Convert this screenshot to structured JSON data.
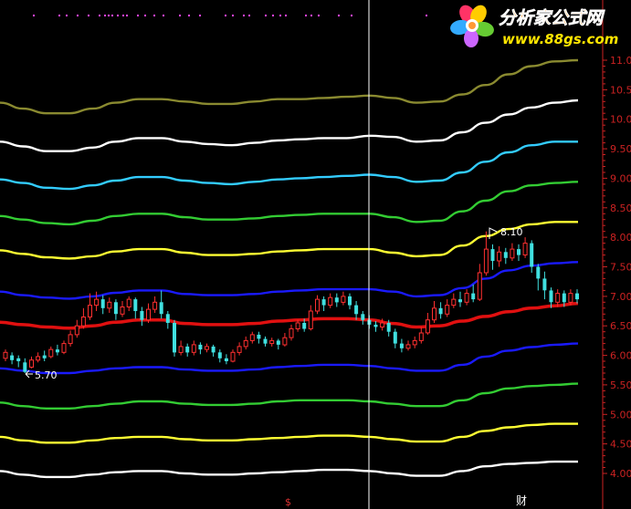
{
  "logo": {
    "title": "分析家公式网",
    "url": "www.88gs.com"
  },
  "price_axis": {
    "ticks": [
      "11.00",
      "10.50",
      "10.00",
      "9.50",
      "9.00",
      "8.50",
      "8.00",
      "7.50",
      "7.00",
      "6.50",
      "6.00",
      "5.50",
      "5.00",
      "4.50",
      "4.00"
    ],
    "tick_values": [
      11.0,
      10.5,
      10.0,
      9.5,
      9.0,
      8.5,
      8.0,
      7.5,
      7.0,
      6.5,
      6.0,
      5.5,
      5.0,
      4.5,
      4.0
    ],
    "color": "#cc2222"
  },
  "annotations": {
    "high_label": "8.10",
    "low_label": "5.70"
  },
  "bottom_markers": {
    "left": "$",
    "right": "财"
  },
  "chart_data": {
    "type": "line",
    "ylim": [
      3.9,
      11.25
    ],
    "bands": [
      {
        "color": "#8a8a30",
        "values": [
          10.28,
          10.18,
          10.1,
          10.1,
          10.18,
          10.28,
          10.34,
          10.34,
          10.3,
          10.26,
          10.26,
          10.3,
          10.34,
          10.34,
          10.36,
          10.38,
          10.4,
          10.36,
          10.28,
          10.3,
          10.42,
          10.58,
          10.76,
          10.9,
          10.98,
          11.0
        ]
      },
      {
        "color": "#ffffff",
        "values": [
          9.62,
          9.54,
          9.46,
          9.46,
          9.52,
          9.62,
          9.68,
          9.68,
          9.62,
          9.58,
          9.56,
          9.6,
          9.64,
          9.66,
          9.68,
          9.68,
          9.72,
          9.7,
          9.62,
          9.64,
          9.78,
          9.94,
          10.08,
          10.2,
          10.28,
          10.32
        ]
      },
      {
        "color": "#33ccff",
        "values": [
          8.98,
          8.92,
          8.84,
          8.82,
          8.88,
          8.96,
          9.02,
          9.02,
          8.96,
          8.92,
          8.9,
          8.94,
          8.98,
          9.0,
          9.02,
          9.04,
          9.06,
          9.02,
          8.94,
          8.96,
          9.1,
          9.28,
          9.44,
          9.56,
          9.62,
          9.62
        ]
      },
      {
        "color": "#33cc33",
        "values": [
          8.36,
          8.3,
          8.24,
          8.22,
          8.28,
          8.36,
          8.4,
          8.4,
          8.34,
          8.3,
          8.3,
          8.32,
          8.36,
          8.38,
          8.4,
          8.4,
          8.4,
          8.34,
          8.26,
          8.28,
          8.44,
          8.62,
          8.78,
          8.88,
          8.92,
          8.94
        ]
      },
      {
        "color": "#ffff33",
        "values": [
          7.78,
          7.72,
          7.66,
          7.64,
          7.68,
          7.76,
          7.8,
          7.8,
          7.74,
          7.7,
          7.7,
          7.72,
          7.76,
          7.78,
          7.8,
          7.8,
          7.8,
          7.74,
          7.68,
          7.7,
          7.86,
          8.02,
          8.14,
          8.22,
          8.26,
          8.26
        ]
      },
      {
        "color": "#1a1aff",
        "values": [
          7.08,
          7.02,
          6.98,
          6.96,
          7.0,
          7.06,
          7.1,
          7.1,
          7.04,
          7.02,
          7.02,
          7.04,
          7.08,
          7.1,
          7.12,
          7.12,
          7.12,
          7.08,
          7.0,
          7.02,
          7.14,
          7.3,
          7.44,
          7.52,
          7.56,
          7.58
        ]
      },
      {
        "color": "#e01010",
        "width": 3.5,
        "values": [
          6.56,
          6.52,
          6.48,
          6.46,
          6.5,
          6.56,
          6.6,
          6.6,
          6.54,
          6.52,
          6.52,
          6.54,
          6.58,
          6.6,
          6.62,
          6.62,
          6.6,
          6.54,
          6.48,
          6.5,
          6.58,
          6.66,
          6.74,
          6.8,
          6.84,
          6.88
        ]
      },
      {
        "color": "#1a1aff",
        "values": [
          5.78,
          5.74,
          5.7,
          5.7,
          5.74,
          5.78,
          5.8,
          5.8,
          5.76,
          5.74,
          5.74,
          5.76,
          5.8,
          5.82,
          5.84,
          5.84,
          5.82,
          5.78,
          5.74,
          5.74,
          5.84,
          5.98,
          6.08,
          6.14,
          6.18,
          6.2
        ]
      },
      {
        "color": "#33cc33",
        "values": [
          5.2,
          5.14,
          5.1,
          5.1,
          5.14,
          5.18,
          5.22,
          5.22,
          5.18,
          5.16,
          5.16,
          5.18,
          5.22,
          5.24,
          5.24,
          5.24,
          5.22,
          5.18,
          5.14,
          5.14,
          5.24,
          5.36,
          5.44,
          5.48,
          5.5,
          5.52
        ]
      },
      {
        "color": "#ffff33",
        "values": [
          4.62,
          4.56,
          4.52,
          4.52,
          4.56,
          4.6,
          4.62,
          4.62,
          4.58,
          4.56,
          4.56,
          4.58,
          4.6,
          4.62,
          4.64,
          4.64,
          4.62,
          4.58,
          4.54,
          4.54,
          4.62,
          4.72,
          4.78,
          4.82,
          4.84,
          4.84
        ]
      },
      {
        "color": "#ffffff",
        "values": [
          4.04,
          3.98,
          3.94,
          3.94,
          3.98,
          4.02,
          4.04,
          4.04,
          4.0,
          3.98,
          3.98,
          4.0,
          4.02,
          4.04,
          4.06,
          4.06,
          4.04,
          4.0,
          3.96,
          3.96,
          4.04,
          4.12,
          4.16,
          4.18,
          4.2,
          4.2
        ]
      }
    ],
    "candles": [
      [
        5.95,
        6.05,
        6.1,
        5.9
      ],
      [
        6.0,
        5.92,
        6.05,
        5.85
      ],
      [
        5.95,
        5.9,
        6.0,
        5.8
      ],
      [
        5.88,
        5.72,
        5.95,
        5.7
      ],
      [
        5.8,
        5.92,
        5.98,
        5.78
      ],
      [
        5.92,
        5.98,
        6.05,
        5.88
      ],
      [
        6.0,
        5.95,
        6.08,
        5.9
      ],
      [
        5.98,
        6.1,
        6.15,
        5.95
      ],
      [
        6.1,
        6.05,
        6.18,
        6.0
      ],
      [
        6.05,
        6.2,
        6.25,
        6.02
      ],
      [
        6.2,
        6.35,
        6.42,
        6.15
      ],
      [
        6.35,
        6.5,
        6.6,
        6.3
      ],
      [
        6.5,
        6.65,
        6.8,
        6.45
      ],
      [
        6.65,
        6.85,
        7.05,
        6.6
      ],
      [
        6.85,
        6.95,
        7.08,
        6.75
      ],
      [
        6.95,
        6.8,
        7.02,
        6.7
      ],
      [
        6.8,
        6.9,
        6.98,
        6.72
      ],
      [
        6.9,
        6.7,
        6.95,
        6.6
      ],
      [
        6.7,
        6.82,
        6.92,
        6.65
      ],
      [
        6.82,
        6.95,
        7.0,
        6.75
      ],
      [
        6.95,
        6.75,
        6.98,
        6.62
      ],
      [
        6.75,
        6.6,
        6.82,
        6.5
      ],
      [
        6.6,
        6.78,
        6.88,
        6.55
      ],
      [
        6.78,
        6.9,
        7.0,
        6.72
      ],
      [
        6.9,
        6.7,
        7.1,
        6.62
      ],
      [
        6.7,
        6.55,
        6.75,
        6.45
      ],
      [
        6.55,
        6.05,
        6.6,
        5.98
      ],
      [
        6.05,
        6.15,
        6.25,
        6.0
      ],
      [
        6.15,
        6.05,
        6.2,
        5.98
      ],
      [
        6.05,
        6.18,
        6.25,
        6.0
      ],
      [
        6.18,
        6.1,
        6.22,
        6.02
      ],
      [
        6.1,
        6.15,
        6.2,
        6.05
      ],
      [
        6.15,
        6.05,
        6.18,
        5.98
      ],
      [
        6.05,
        5.95,
        6.1,
        5.88
      ],
      [
        5.95,
        5.9,
        6.02,
        5.85
      ],
      [
        5.9,
        6.05,
        6.1,
        5.88
      ],
      [
        6.05,
        6.15,
        6.22,
        6.0
      ],
      [
        6.15,
        6.25,
        6.32,
        6.1
      ],
      [
        6.25,
        6.35,
        6.4,
        6.2
      ],
      [
        6.35,
        6.28,
        6.4,
        6.2
      ],
      [
        6.28,
        6.2,
        6.32,
        6.15
      ],
      [
        6.2,
        6.25,
        6.3,
        6.15
      ],
      [
        6.25,
        6.18,
        6.28,
        6.1
      ],
      [
        6.18,
        6.3,
        6.38,
        6.15
      ],
      [
        6.3,
        6.45,
        6.52,
        6.25
      ],
      [
        6.45,
        6.55,
        6.6,
        6.4
      ],
      [
        6.55,
        6.45,
        6.62,
        6.4
      ],
      [
        6.45,
        6.75,
        6.85,
        6.42
      ],
      [
        6.75,
        6.95,
        7.02,
        6.7
      ],
      [
        6.95,
        6.85,
        7.0,
        6.75
      ],
      [
        6.85,
        6.98,
        7.05,
        6.8
      ],
      [
        6.98,
        6.9,
        7.05,
        6.82
      ],
      [
        6.9,
        7.0,
        7.08,
        6.85
      ],
      [
        7.0,
        6.85,
        7.05,
        6.78
      ],
      [
        6.85,
        6.7,
        6.92,
        6.6
      ],
      [
        6.7,
        6.6,
        6.75,
        6.52
      ],
      [
        6.6,
        6.52,
        6.68,
        6.45
      ],
      [
        6.52,
        6.48,
        6.58,
        6.4
      ],
      [
        6.48,
        6.55,
        6.62,
        6.42
      ],
      [
        6.55,
        6.4,
        6.6,
        6.32
      ],
      [
        6.4,
        6.2,
        6.45,
        6.12
      ],
      [
        6.2,
        6.12,
        6.28,
        6.05
      ],
      [
        6.12,
        6.18,
        6.25,
        6.08
      ],
      [
        6.18,
        6.25,
        6.32,
        6.12
      ],
      [
        6.25,
        6.38,
        6.48,
        6.2
      ],
      [
        6.38,
        6.6,
        6.72,
        6.35
      ],
      [
        6.6,
        6.8,
        6.92,
        6.55
      ],
      [
        6.8,
        6.7,
        6.9,
        6.62
      ],
      [
        6.7,
        6.85,
        6.95,
        6.65
      ],
      [
        6.85,
        6.95,
        7.05,
        6.8
      ],
      [
        6.95,
        6.9,
        7.08,
        6.82
      ],
      [
        6.9,
        7.05,
        7.12,
        6.85
      ],
      [
        7.05,
        6.95,
        7.2,
        6.9
      ],
      [
        6.95,
        7.4,
        7.55,
        6.92
      ],
      [
        7.4,
        7.8,
        8.1,
        7.35
      ],
      [
        7.8,
        7.6,
        7.88,
        7.45
      ],
      [
        7.6,
        7.75,
        7.85,
        7.5
      ],
      [
        7.75,
        7.65,
        7.82,
        7.55
      ],
      [
        7.65,
        7.8,
        7.9,
        7.6
      ],
      [
        7.8,
        7.7,
        7.88,
        7.6
      ],
      [
        7.7,
        7.9,
        8.0,
        7.65
      ],
      [
        7.9,
        7.5,
        7.95,
        7.4
      ],
      [
        7.5,
        7.3,
        7.55,
        7.1
      ],
      [
        7.3,
        7.1,
        7.42,
        6.95
      ],
      [
        7.1,
        6.9,
        7.15,
        6.8
      ],
      [
        6.9,
        7.05,
        7.12,
        6.82
      ],
      [
        7.05,
        6.9,
        7.1,
        6.82
      ],
      [
        6.9,
        7.05,
        7.12,
        6.85
      ],
      [
        7.05,
        6.95,
        7.12,
        6.88
      ]
    ]
  }
}
